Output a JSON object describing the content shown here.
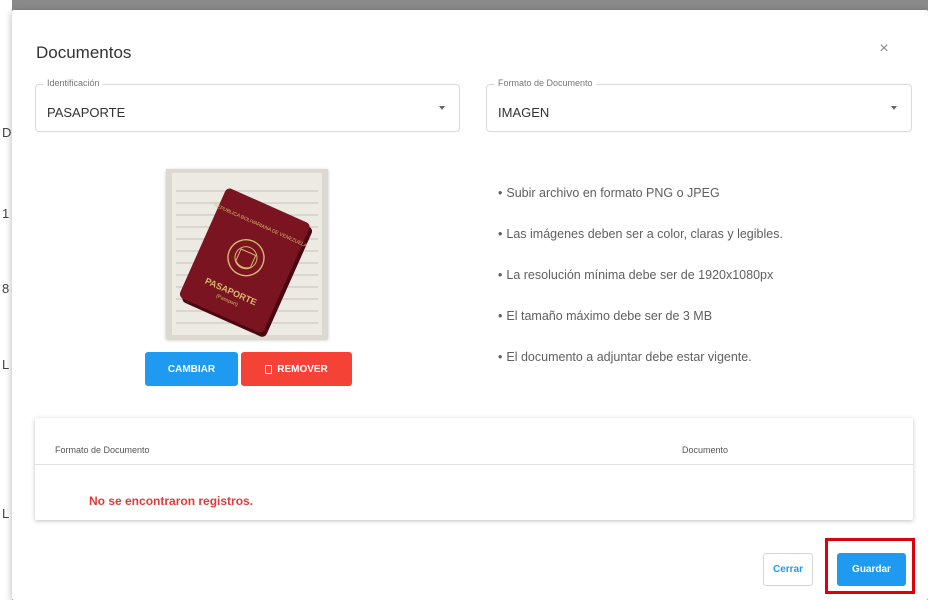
{
  "background": {
    "edge_chars": [
      "D",
      "1",
      "8",
      "L",
      "L"
    ]
  },
  "modal": {
    "title": "Documentos",
    "close_symbol": "×"
  },
  "identificacion": {
    "label": "Identificación",
    "value": "PASAPORTE"
  },
  "formato": {
    "label": "Formato de Documento",
    "value": "IMAGEN"
  },
  "preview": {
    "passport_text_top": "REPUBLICA BOLIVARIANA DE VENEZUELA",
    "passport_text_bottom": "PASAPORTE",
    "passport_text_sub": "(Passport)"
  },
  "buttons": {
    "change": "CAMBIAR",
    "remove": "REMOVER",
    "close": "Cerrar",
    "save": "Guardar"
  },
  "requirements": [
    "Subir archivo en formato PNG o JPEG",
    "Las imágenes deben ser a color, claras y legibles.",
    "La resolución mínima debe ser de 1920x1080px",
    "El tamaño máximo debe ser de 3 MB",
    "El documento a adjuntar debe estar vigente."
  ],
  "table": {
    "columns": [
      "Formato de Documento",
      "Documento"
    ],
    "empty_message": "No se encontraron registros."
  },
  "colors": {
    "primary": "#1e9bf0",
    "danger": "#f44336",
    "error_text": "#e53935",
    "highlight": "#e0000b"
  }
}
